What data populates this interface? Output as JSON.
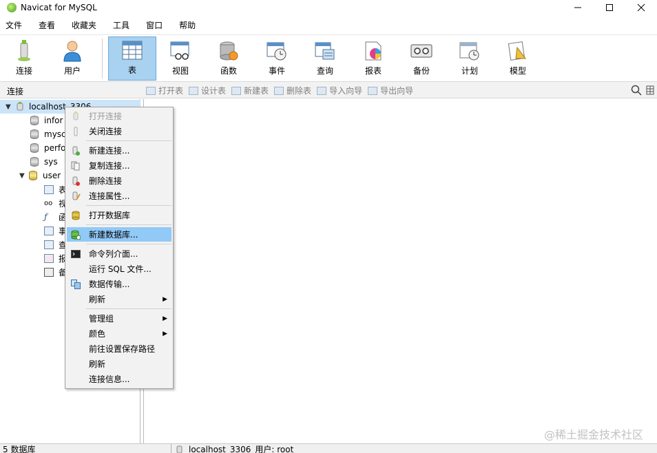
{
  "window": {
    "title": "Navicat for MySQL"
  },
  "menu": [
    "文件",
    "查看",
    "收藏夹",
    "工具",
    "窗口",
    "帮助"
  ],
  "toolbar": {
    "left": [
      {
        "label": "连接",
        "icon": "connection-icon"
      },
      {
        "label": "用户",
        "icon": "user-icon"
      }
    ],
    "right": [
      {
        "label": "表",
        "icon": "table-icon",
        "active": true
      },
      {
        "label": "视图",
        "icon": "view-icon"
      },
      {
        "label": "函数",
        "icon": "function-icon"
      },
      {
        "label": "事件",
        "icon": "event-icon"
      },
      {
        "label": "查询",
        "icon": "query-icon"
      },
      {
        "label": "报表",
        "icon": "report-icon"
      },
      {
        "label": "备份",
        "icon": "backup-icon"
      },
      {
        "label": "计划",
        "icon": "schedule-icon"
      },
      {
        "label": "模型",
        "icon": "model-icon"
      }
    ]
  },
  "subbar": {
    "connection_label": "连接",
    "actions": [
      "打开表",
      "设计表",
      "新建表",
      "删除表",
      "导入向导",
      "导出向导"
    ]
  },
  "tree": {
    "root": "localhost_3306",
    "items": [
      {
        "label": "infor",
        "open": false
      },
      {
        "label": "mysc",
        "open": false
      },
      {
        "label": "perfo",
        "open": false
      },
      {
        "label": "sys",
        "open": false
      },
      {
        "label": "user",
        "open": true
      }
    ],
    "children": [
      "表",
      "视",
      "函",
      "事",
      "查",
      "报",
      "备"
    ]
  },
  "context_menu": {
    "groups": [
      [
        {
          "label": "打开连接",
          "disabled": true,
          "icon": "open-connection-icon"
        },
        {
          "label": "关闭连接",
          "disabled": false,
          "icon": "close-connection-icon"
        }
      ],
      [
        {
          "label": "新建连接...",
          "icon": "new-connection-icon"
        },
        {
          "label": "复制连接...",
          "icon": "copy-connection-icon"
        },
        {
          "label": "删除连接",
          "icon": "delete-connection-icon"
        },
        {
          "label": "连接属性...",
          "icon": "connection-properties-icon"
        }
      ],
      [
        {
          "label": "打开数据库",
          "icon": "open-database-icon"
        }
      ],
      [
        {
          "label": "新建数据库...",
          "icon": "new-database-icon",
          "highlighted": true
        }
      ],
      [
        {
          "label": "命令列介面...",
          "icon": "console-icon"
        },
        {
          "label": "运行 SQL 文件...",
          "icon": ""
        },
        {
          "label": "数据传输...",
          "icon": "data-transfer-icon"
        },
        {
          "label": "刷新",
          "icon": "",
          "submenu": true
        }
      ],
      [
        {
          "label": "管理组",
          "icon": "",
          "submenu": true
        },
        {
          "label": "颜色",
          "icon": "",
          "submenu": true
        },
        {
          "label": "前往设置保存路径",
          "icon": ""
        },
        {
          "label": "刷新",
          "icon": ""
        },
        {
          "label": "连接信息...",
          "icon": ""
        }
      ]
    ]
  },
  "status": {
    "left": "5 数据库",
    "connection": "localhost_3306",
    "user": "用户: root"
  },
  "watermark": "@稀土掘金技术社区",
  "colors": {
    "active_toolbar": "#a9d2f0",
    "menu_highlight": "#91c9f7",
    "tree_selected": "#cce4f7"
  }
}
